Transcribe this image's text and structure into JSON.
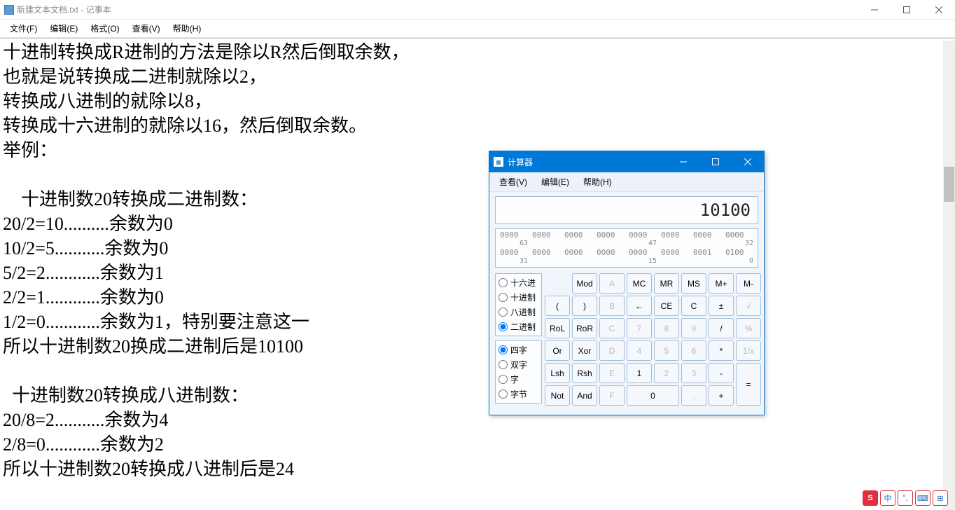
{
  "notepad": {
    "title": "新建文本文档.txt - 记事本",
    "menu": [
      "文件(F)",
      "编辑(E)",
      "格式(O)",
      "查看(V)",
      "帮助(H)"
    ],
    "content": "十进制转换成R进制的方法是除以R然后倒取余数，\n也就是说转换成二进制就除以2，\n转换成八进制的就除以8，\n转换成十六进制的就除以16，然后倒取余数。\n举例：\n\n    十进制数20转换成二进制数：\n20/2=10..........余数为0\n10/2=5...........余数为0\n5/2=2............余数为1\n2/2=1............余数为0\n1/2=0............余数为1，特别要注意这一\n所以十进制数20换成二进制后是10100    \n\n  十进制数20转换成八进制数：\n20/8=2...........余数为4\n2/8=0............余数为2\n所以十进制数20转换成八进制后是24"
  },
  "calculator": {
    "title": "计算器",
    "menu": [
      "查看(V)",
      "编辑(E)",
      "帮助(H)"
    ],
    "display": "10100",
    "bits": {
      "row1": [
        "0000",
        "0000",
        "0000",
        "0000",
        "0000",
        "0000",
        "0000",
        "0000"
      ],
      "lab1": [
        "63",
        "",
        "",
        "",
        "47",
        "",
        "",
        "32"
      ],
      "row2": [
        "0000",
        "0000",
        "0000",
        "0000",
        "0000",
        "0000",
        "0001",
        "0100"
      ],
      "lab2": [
        "31",
        "",
        "",
        "",
        "15",
        "",
        "",
        "0"
      ]
    },
    "radix": {
      "items": [
        {
          "label": "十六进",
          "value": "hex",
          "checked": false
        },
        {
          "label": "十进制",
          "value": "dec",
          "checked": false
        },
        {
          "label": "八进制",
          "value": "oct",
          "checked": false
        },
        {
          "label": "二进制",
          "value": "bin",
          "checked": true
        }
      ]
    },
    "wordsize": {
      "items": [
        {
          "label": "四字",
          "value": "qword",
          "checked": true
        },
        {
          "label": "双字",
          "value": "dword",
          "checked": false
        },
        {
          "label": "字",
          "value": "word",
          "checked": false
        },
        {
          "label": "字节",
          "value": "byte",
          "checked": false
        }
      ]
    },
    "buttons": {
      "r1": [
        "",
        "Mod",
        "A",
        "MC",
        "MR",
        "MS",
        "M+",
        "M-"
      ],
      "r2": [
        "(",
        ")",
        "B",
        "←",
        "CE",
        "C",
        "±",
        "√"
      ],
      "r3": [
        "RoL",
        "RoR",
        "C",
        "7",
        "8",
        "9",
        "/",
        "%"
      ],
      "r4": [
        "Or",
        "Xor",
        "D",
        "4",
        "5",
        "6",
        "*",
        "1/x"
      ],
      "r5": [
        "Lsh",
        "Rsh",
        "E",
        "1",
        "2",
        "3",
        "-",
        "="
      ],
      "r6": [
        "Not",
        "And",
        "F",
        "0",
        ".",
        "+"
      ]
    }
  },
  "ime": {
    "items": [
      "S",
      "中",
      "°,",
      "⌨",
      "⊞"
    ]
  }
}
